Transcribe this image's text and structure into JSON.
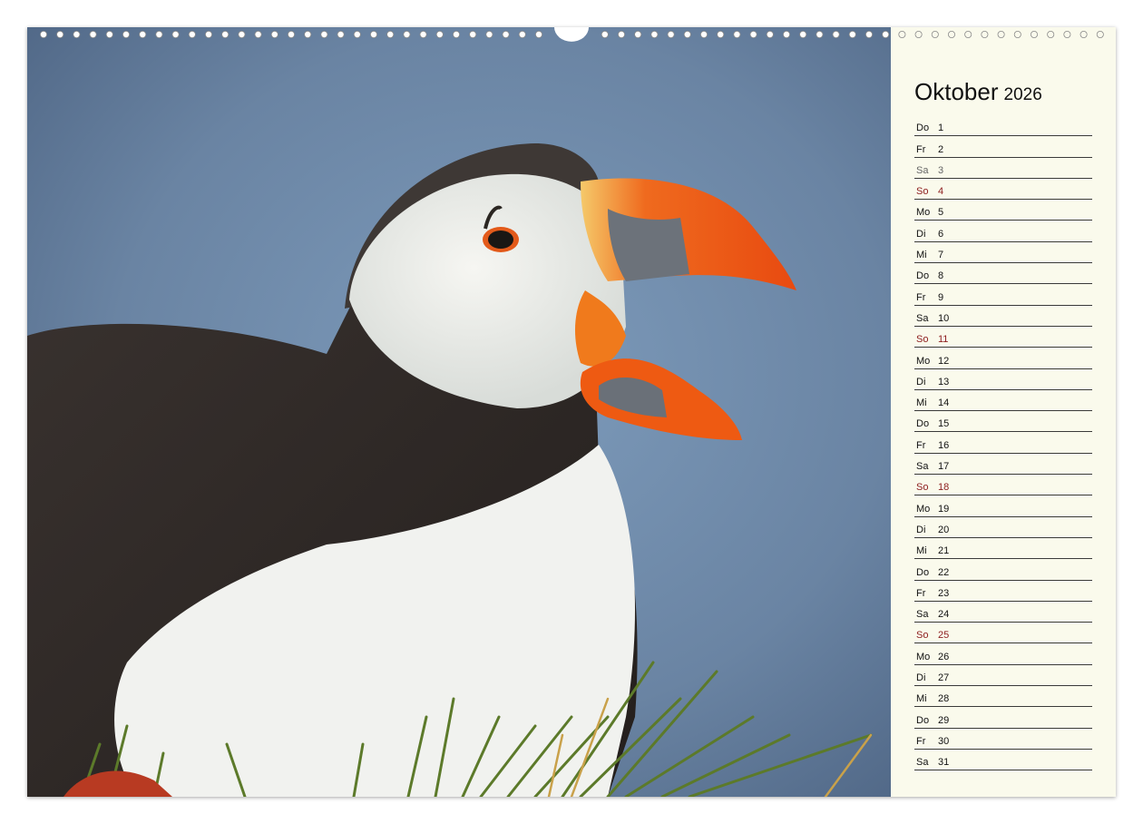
{
  "calendar": {
    "month": "Oktober",
    "year": "2026",
    "days": [
      {
        "wd": "Do",
        "d": "1",
        "type": "weekday"
      },
      {
        "wd": "Fr",
        "d": "2",
        "type": "weekday"
      },
      {
        "wd": "Sa",
        "d": "3",
        "type": "sat"
      },
      {
        "wd": "So",
        "d": "4",
        "type": "sun"
      },
      {
        "wd": "Mo",
        "d": "5",
        "type": "weekday"
      },
      {
        "wd": "Di",
        "d": "6",
        "type": "weekday"
      },
      {
        "wd": "Mi",
        "d": "7",
        "type": "weekday"
      },
      {
        "wd": "Do",
        "d": "8",
        "type": "weekday"
      },
      {
        "wd": "Fr",
        "d": "9",
        "type": "weekday"
      },
      {
        "wd": "Sa",
        "d": "10",
        "type": "weekday"
      },
      {
        "wd": "So",
        "d": "11",
        "type": "sun"
      },
      {
        "wd": "Mo",
        "d": "12",
        "type": "weekday"
      },
      {
        "wd": "Di",
        "d": "13",
        "type": "weekday"
      },
      {
        "wd": "Mi",
        "d": "14",
        "type": "weekday"
      },
      {
        "wd": "Do",
        "d": "15",
        "type": "weekday"
      },
      {
        "wd": "Fr",
        "d": "16",
        "type": "weekday"
      },
      {
        "wd": "Sa",
        "d": "17",
        "type": "weekday"
      },
      {
        "wd": "So",
        "d": "18",
        "type": "sun"
      },
      {
        "wd": "Mo",
        "d": "19",
        "type": "weekday"
      },
      {
        "wd": "Di",
        "d": "20",
        "type": "weekday"
      },
      {
        "wd": "Mi",
        "d": "21",
        "type": "weekday"
      },
      {
        "wd": "Do",
        "d": "22",
        "type": "weekday"
      },
      {
        "wd": "Fr",
        "d": "23",
        "type": "weekday"
      },
      {
        "wd": "Sa",
        "d": "24",
        "type": "weekday"
      },
      {
        "wd": "So",
        "d": "25",
        "type": "sun"
      },
      {
        "wd": "Mo",
        "d": "26",
        "type": "weekday"
      },
      {
        "wd": "Di",
        "d": "27",
        "type": "weekday"
      },
      {
        "wd": "Mi",
        "d": "28",
        "type": "weekday"
      },
      {
        "wd": "Do",
        "d": "29",
        "type": "weekday"
      },
      {
        "wd": "Fr",
        "d": "30",
        "type": "weekday"
      },
      {
        "wd": "Sa",
        "d": "31",
        "type": "weekday"
      }
    ]
  },
  "photo": {
    "subject": "puffin-photo"
  },
  "colors": {
    "sunday": "#8e2020",
    "saturday": "#666666",
    "panel": "#fafaec",
    "sky": "#6d87a6",
    "beak": "#f05a14"
  }
}
